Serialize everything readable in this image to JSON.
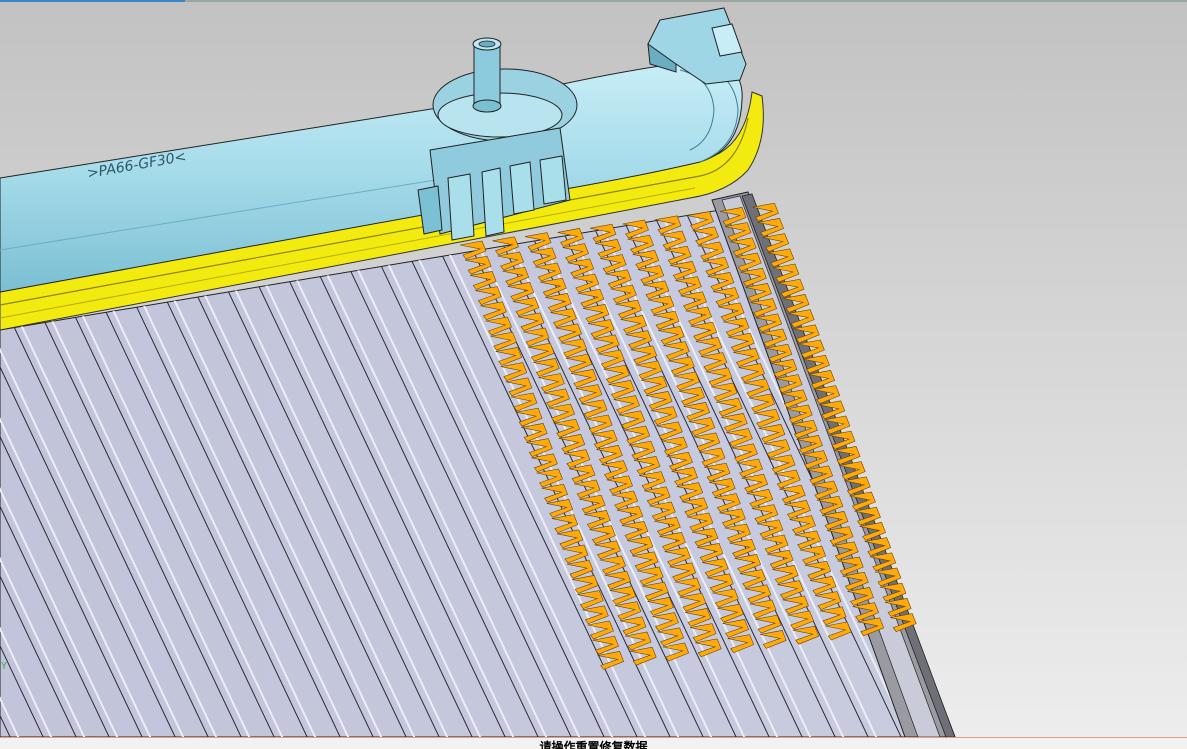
{
  "viewport": {
    "part_marking": ">PA66-GF30<",
    "triad_label": "Y",
    "colors": {
      "background_top": "#c4c4c4",
      "background_bottom": "#ececec",
      "tank": "#a6dcea",
      "gasket": "#f5ee10",
      "core": "#c3c6dc",
      "fins": "#ffaa0a",
      "side_plate": "#8a8a92"
    },
    "fin_grid": {
      "columns": 10,
      "rows_per_column": 28
    }
  },
  "status": {
    "prompt_text": "请操作重置修复数据"
  }
}
